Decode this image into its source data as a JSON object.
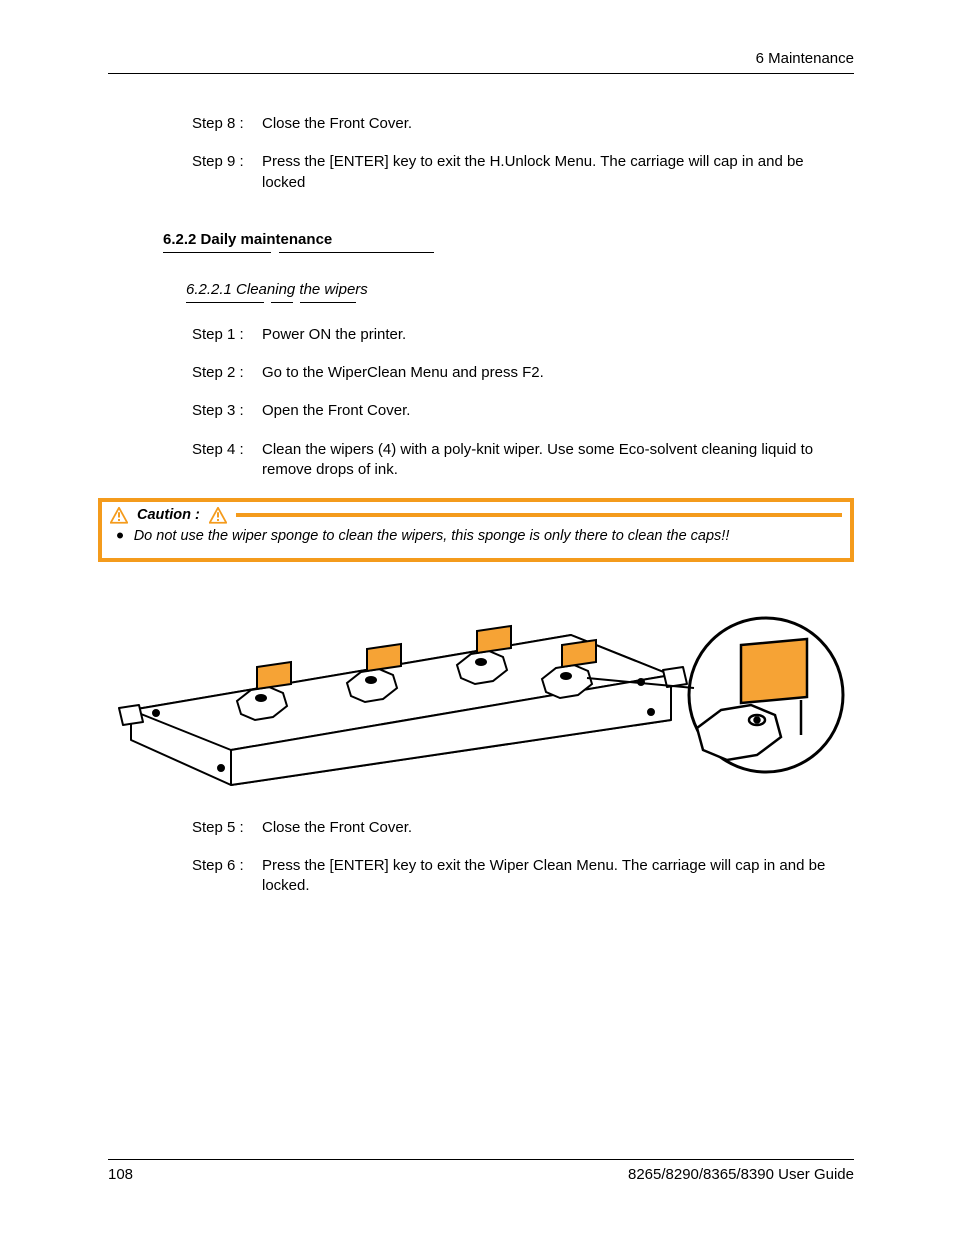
{
  "header": {
    "chapter": "6 Maintenance"
  },
  "section1": {
    "step8": {
      "label": "Step 8 :",
      "text": "Close the Front Cover."
    },
    "step9": {
      "label": "Step 9 :",
      "text": "Press the [ENTER] key to exit the H.Unlock Menu.  The carriage will cap in and be locked"
    }
  },
  "heading_main": "6.2.2 Daily maintenance",
  "heading_sub": "6.2.2.1 Cleaning the wipers",
  "section2": {
    "step1": {
      "label": "Step 1 :",
      "text": "Power ON the printer."
    },
    "step2": {
      "label": "Step 2 :",
      "text": "Go to the WiperClean Menu and press F2."
    },
    "step3": {
      "label": "Step 3 :",
      "text": "Open the Front Cover."
    },
    "step4": {
      "label": "Step 4 :",
      "text": "Clean the wipers (4) with a poly-knit wiper.  Use some Eco-solvent cleaning liquid to remove drops of ink."
    }
  },
  "caution": {
    "label": "Caution :",
    "text": "Do not use the wiper sponge to clean the wipers, this sponge is only there to clean the caps!!"
  },
  "section3": {
    "step5": {
      "label": "Step 5 :",
      "text": "Close the Front Cover."
    },
    "step6": {
      "label": "Step 6 :",
      "text": "Press the [ENTER] key to exit the Wiper Clean Menu.  The carriage will cap in and be locked."
    }
  },
  "footer": {
    "page": "108",
    "doc": "8265/8290/8365/8390 User Guide"
  }
}
